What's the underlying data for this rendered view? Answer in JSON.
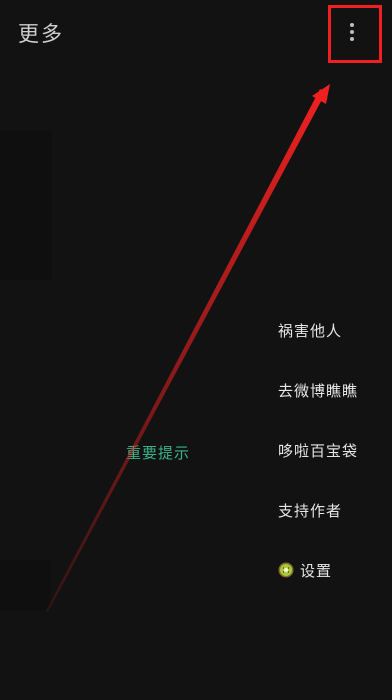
{
  "toolbar": {
    "title": "更多",
    "overflow_icon": "more-vert-icon"
  },
  "menu": {
    "items": [
      {
        "label": "祸害他人"
      },
      {
        "label": "去微博瞧瞧"
      },
      {
        "label": "哆啦百宝袋"
      },
      {
        "label": "支持作者"
      },
      {
        "label": "设置",
        "icon": "kiwi-icon"
      }
    ]
  },
  "content": {
    "tip": "重要提示"
  },
  "annotation": {
    "arrow_color": "#f02020",
    "box_color": "#f02020"
  }
}
